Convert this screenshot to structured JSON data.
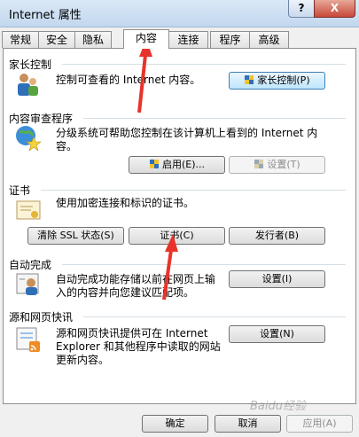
{
  "window": {
    "title": "Internet 属性",
    "help_label": "?",
    "close_label": "X"
  },
  "tabs": [
    {
      "label": "常规"
    },
    {
      "label": "安全"
    },
    {
      "label": "隐私"
    },
    {
      "label": "内容"
    },
    {
      "label": "连接"
    },
    {
      "label": "程序"
    },
    {
      "label": "高级"
    }
  ],
  "parental": {
    "title": "家长控制",
    "desc": "控制可查看的 Internet 内容。",
    "button": "家长控制(P)"
  },
  "advisor": {
    "title": "内容审查程序",
    "desc_line1": "分级系统可帮助您控制在该计算机上看到的 Internet 内",
    "desc_line2": "容。",
    "enable_button": "启用(E)...",
    "settings_button": "设置(T)"
  },
  "certificates": {
    "title": "证书",
    "desc": "使用加密连接和标识的证书。",
    "clear_ssl_button": "清除 SSL 状态(S)",
    "certs_button": "证书(C)",
    "publishers_button": "发行者(B)"
  },
  "autocomplete": {
    "title": "自动完成",
    "desc_line1": "自动完成功能存储以前在网页上输",
    "desc_line2": "入的内容并向您建议匹配项。",
    "settings_button": "设置(I)"
  },
  "feeds": {
    "title": "源和网页快讯",
    "desc_line1": "源和网页快讯提供可在 Internet",
    "desc_line2": "Explorer 和其他程序中读取的网站",
    "desc_line3": "更新内容。",
    "settings_button": "设置(N)"
  },
  "footer": {
    "ok": "确定",
    "cancel": "取消",
    "apply": "应用(A)"
  },
  "watermark": "Baidu经验",
  "colors": {
    "arrow": "#e8332a",
    "title_bar": "#c2d7ee"
  }
}
